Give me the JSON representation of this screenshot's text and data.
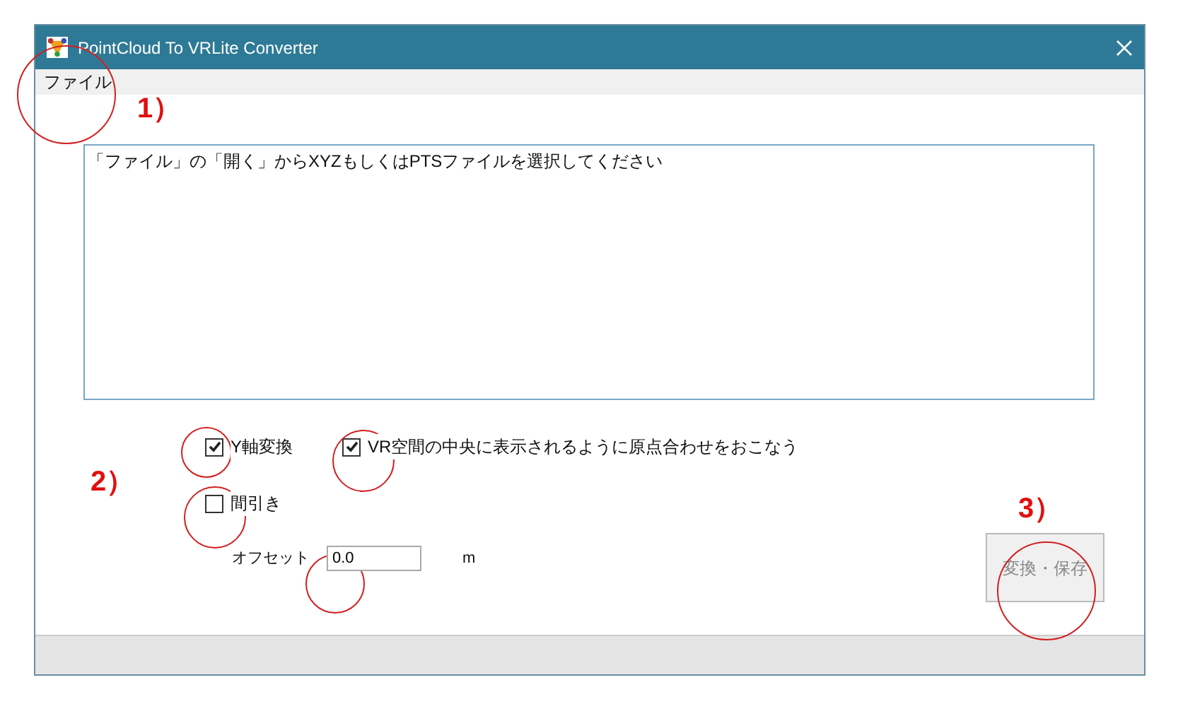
{
  "window": {
    "title": "PointCloud To VRLite Converter"
  },
  "menu": [
    {
      "label": "ファイル"
    }
  ],
  "message_box": {
    "value": "「ファイル」の「開く」からXYZもしくはPTSファイルを選択してください"
  },
  "options": [
    {
      "label": "Y軸変換",
      "checked": true
    },
    {
      "label": "VR空間の中央に表示されるように原点合わせをおこなう",
      "checked": true
    },
    {
      "label": "間引き",
      "checked": false
    }
  ],
  "offset": {
    "label": "オフセット",
    "value": "0.0",
    "unit": "m"
  },
  "convert_button": {
    "label": "変換・保存",
    "disabled": true
  },
  "annotations": [
    {
      "text": "1）"
    },
    {
      "text": "2）"
    },
    {
      "text": "3）"
    }
  ]
}
